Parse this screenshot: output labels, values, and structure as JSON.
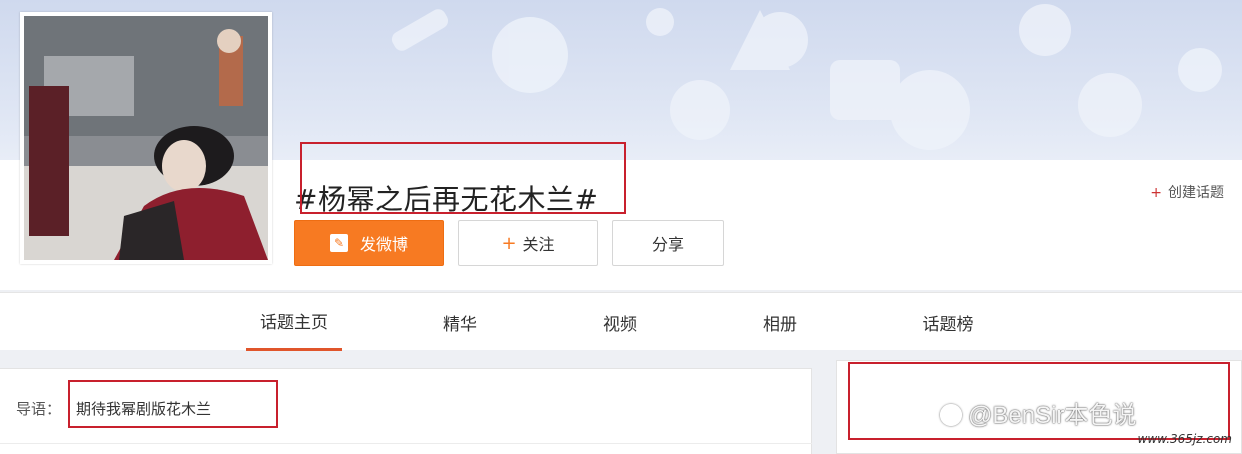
{
  "topic": {
    "title": "#杨幂之后再无花木兰#",
    "create_topic_label": "创建话题"
  },
  "actions": {
    "post_label": "发微博",
    "follow_label": "关注",
    "share_label": "分享"
  },
  "tabs": [
    {
      "label": "话题主页",
      "active": true
    },
    {
      "label": "精华",
      "active": false
    },
    {
      "label": "视频",
      "active": false
    },
    {
      "label": "相册",
      "active": false
    },
    {
      "label": "话题榜",
      "active": false
    }
  ],
  "lead": {
    "label": "导语：",
    "text": "期待我幂剧版花木兰"
  },
  "watermark": {
    "text": "@BenSir本色说",
    "url": "www.365jz.com"
  },
  "colors": {
    "accent_orange": "#f77a22",
    "highlight_red": "#c8202d",
    "tab_underline": "#e0552b"
  }
}
